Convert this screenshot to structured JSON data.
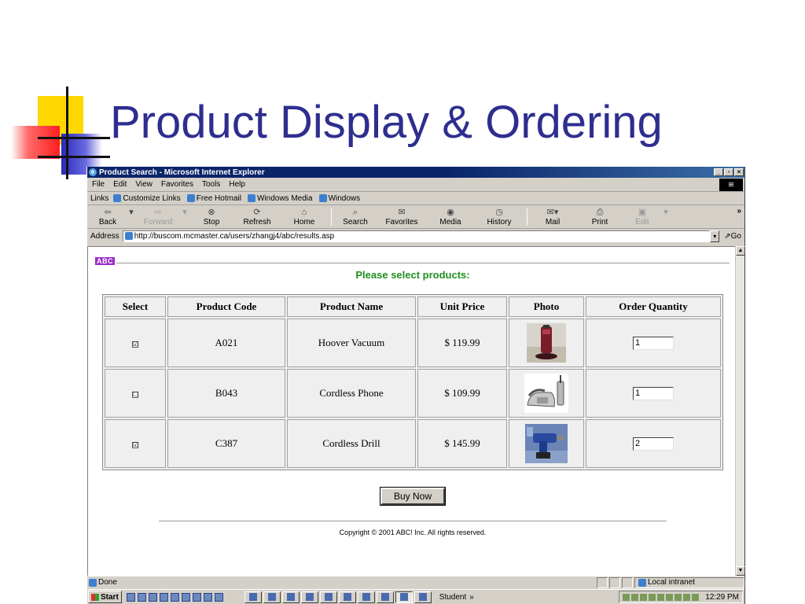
{
  "slide": {
    "title": "Product Display & Ordering"
  },
  "browser": {
    "window_title": "Product Search - Microsoft Internet Explorer",
    "menu": [
      "File",
      "Edit",
      "View",
      "Favorites",
      "Tools",
      "Help"
    ],
    "links_label": "Links",
    "links": [
      "Customize Links",
      "Free Hotmail",
      "Windows Media",
      "Windows"
    ],
    "toolbar": {
      "back": "Back",
      "forward": "Forward",
      "stop": "Stop",
      "refresh": "Refresh",
      "home": "Home",
      "search": "Search",
      "favorites": "Favorites",
      "media": "Media",
      "history": "History",
      "mail": "Mail",
      "print": "Print",
      "edit": "Edit",
      "more": "»"
    },
    "address_label": "Address",
    "address_url": "http://buscom.mcmaster.ca/users/zhangj4/abc/results.asp",
    "go_label": "Go"
  },
  "page": {
    "logo_text": "ABC",
    "heading": "Please select products:",
    "columns": [
      "Select",
      "Product Code",
      "Product Name",
      "Unit Price",
      "Photo",
      "Order Quantity"
    ],
    "rows": [
      {
        "selected": "☑",
        "code": "A021",
        "name": "Hoover Vacuum",
        "price": "$ 119.99",
        "photo": "vacuum",
        "quantity": "1"
      },
      {
        "selected": "☐",
        "code": "B043",
        "name": "Cordless Phone",
        "price": "$ 109.99",
        "photo": "phone",
        "quantity": "1"
      },
      {
        "selected": "☑",
        "code": "C387",
        "name": "Cordless Drill",
        "price": "$ 145.99",
        "photo": "drill",
        "quantity": "2"
      }
    ],
    "buy_button": "Buy Now",
    "copyright": "Copyright © 2001 ABC! Inc. All rights reserved."
  },
  "statusbar": {
    "status": "Done",
    "zone": "Local intranet"
  },
  "taskbar": {
    "start": "Start",
    "user": "Student",
    "chevron": "»",
    "clock": "12:29 PM"
  }
}
